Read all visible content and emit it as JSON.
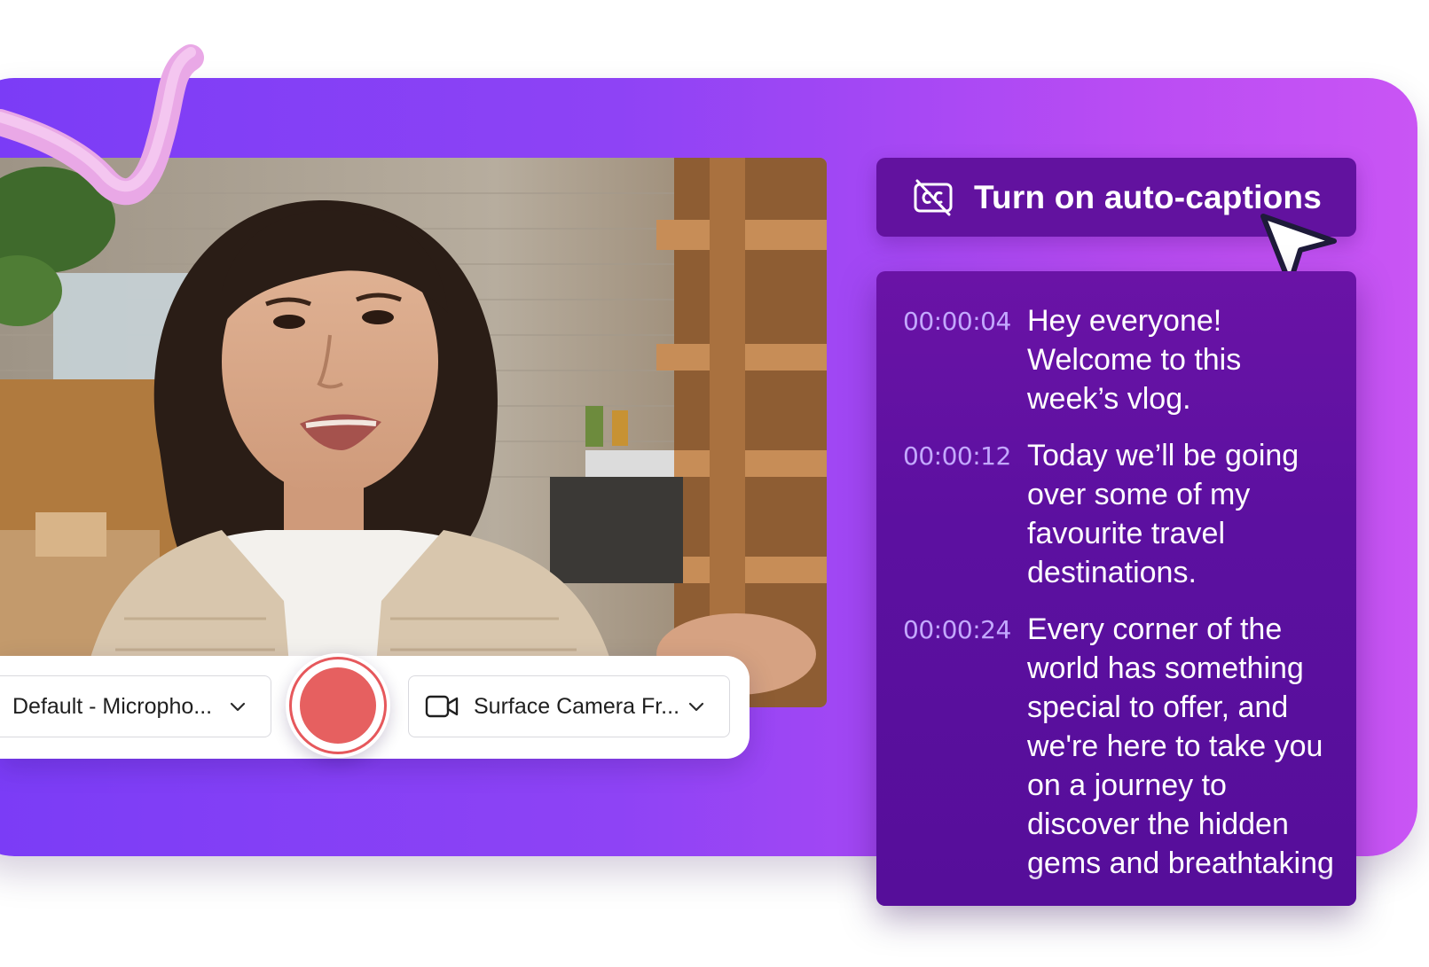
{
  "captions_button": {
    "label": "Turn on auto-captions",
    "icon": "closed-captions-off-icon"
  },
  "controls": {
    "microphone": {
      "selected": "Default - Micropho...",
      "icon": "chevron-down-icon"
    },
    "camera": {
      "selected": "Surface Camera Fr...",
      "icon": "video-camera-icon"
    },
    "record": {
      "icon": "record-icon",
      "color": "#e66060"
    }
  },
  "transcript": {
    "entries": [
      {
        "time": "00:00:04",
        "text": "Hey everyone! Welcome to this week’s vlog."
      },
      {
        "time": "00:00:12",
        "text": "Today we’ll be going over some of my favourite travel destinations."
      },
      {
        "time": "00:00:24",
        "text": "Every corner of the world has something special to offer, and we're here to take you on a journey to discover the hidden gems and breathtaking"
      }
    ]
  },
  "colors": {
    "brand_purple_start": "#7a3cf6",
    "brand_purple_end": "#c955f4",
    "panel": "#5c10a0",
    "timestamp": "#c3a8ff"
  }
}
